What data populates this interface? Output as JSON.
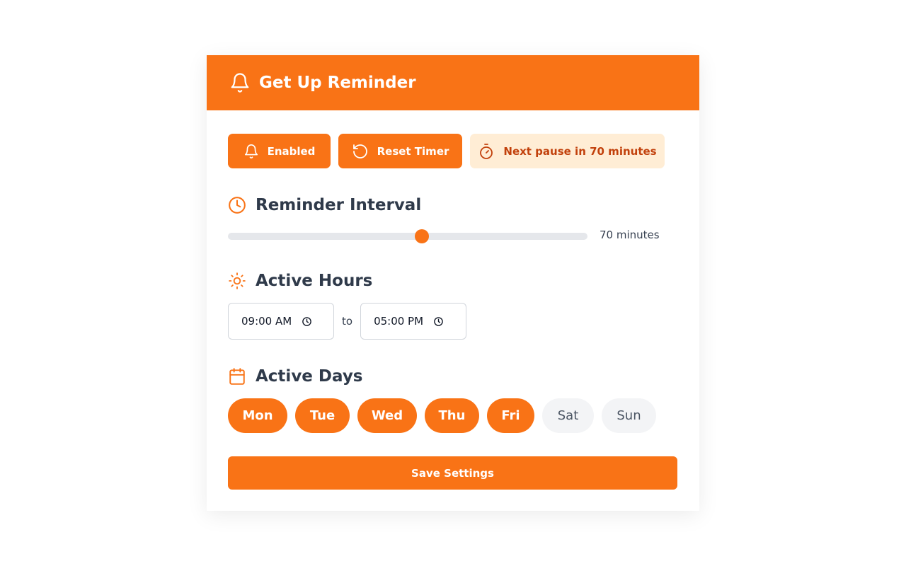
{
  "header": {
    "title": "Get Up Reminder",
    "icon": "bell-icon"
  },
  "controls": {
    "enabled_label": "Enabled",
    "reset_label": "Reset Timer",
    "status_text": "Next pause in 70 minutes"
  },
  "interval": {
    "title": "Reminder Interval",
    "value_label": "70 minutes",
    "value_fraction": 0.54
  },
  "hours": {
    "title": "Active Hours",
    "start": "09:00 AM",
    "end": "05:00 PM",
    "separator": "to"
  },
  "days": {
    "title": "Active Days",
    "items": [
      {
        "label": "Mon",
        "active": true
      },
      {
        "label": "Tue",
        "active": true
      },
      {
        "label": "Wed",
        "active": true
      },
      {
        "label": "Thu",
        "active": true
      },
      {
        "label": "Fri",
        "active": true
      },
      {
        "label": "Sat",
        "active": false
      },
      {
        "label": "Sun",
        "active": false
      }
    ]
  },
  "save_label": "Save Settings",
  "colors": {
    "accent": "#f97316",
    "status_bg": "#ffedd5",
    "status_text": "#c2410c"
  }
}
